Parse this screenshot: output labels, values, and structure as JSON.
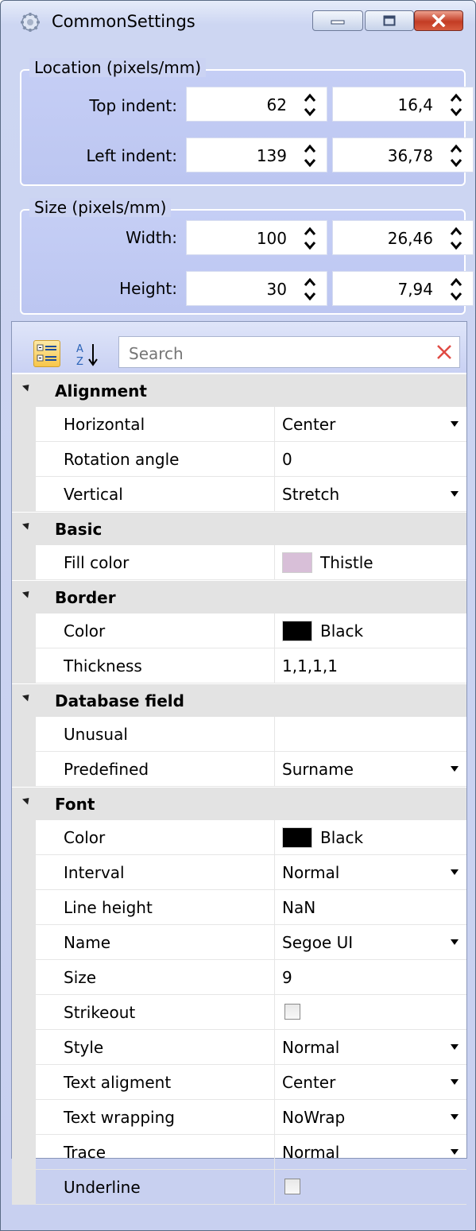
{
  "window": {
    "title": "CommonSettings",
    "icon": "gear-icon",
    "buttons": {
      "minimize": "minimize-icon",
      "maximize": "maximize-icon",
      "close": "close-icon"
    }
  },
  "location": {
    "title": "Location (pixels/mm)",
    "rows": [
      {
        "label": "Top indent:",
        "pixels": "62",
        "mm": "16,4"
      },
      {
        "label": "Left indent:",
        "pixels": "139",
        "mm": "36,78"
      }
    ]
  },
  "size": {
    "title": "Size (pixels/mm)",
    "rows": [
      {
        "label": "Width:",
        "pixels": "100",
        "mm": "26,46"
      },
      {
        "label": "Height:",
        "pixels": "30",
        "mm": "7,94"
      }
    ]
  },
  "toolbar": {
    "categorized_icon": "categorized-icon",
    "sort_icon": "sort-az-icon",
    "search_placeholder": "Search",
    "clear_icon": "clear-search-icon"
  },
  "categories": [
    {
      "name": "Alignment",
      "props": [
        {
          "name": "Horizontal",
          "value": "Center",
          "dropdown": true
        },
        {
          "name": "Rotation angle",
          "value": "0"
        },
        {
          "name": "Vertical",
          "value": "Stretch",
          "dropdown": true
        }
      ]
    },
    {
      "name": "Basic",
      "props": [
        {
          "name": "Fill color",
          "value": "Thistle",
          "swatch": "#d8bfd8"
        }
      ]
    },
    {
      "name": "Border",
      "props": [
        {
          "name": "Color",
          "value": "Black",
          "swatch": "#000000"
        },
        {
          "name": "Thickness",
          "value": "1,1,1,1"
        }
      ]
    },
    {
      "name": "Database field",
      "props": [
        {
          "name": "Unusual",
          "value": ""
        },
        {
          "name": "Predefined",
          "value": "Surname",
          "dropdown": true
        }
      ]
    },
    {
      "name": "Font",
      "props": [
        {
          "name": "Color",
          "value": "Black",
          "swatch": "#000000"
        },
        {
          "name": "Interval",
          "value": "Normal",
          "dropdown": true
        },
        {
          "name": "Line height",
          "value": "NaN"
        },
        {
          "name": "Name",
          "value": "Segoe UI",
          "dropdown": true
        },
        {
          "name": "Size",
          "value": "9"
        },
        {
          "name": "Strikeout",
          "checkbox": true,
          "checked": false
        },
        {
          "name": "Style",
          "value": "Normal",
          "dropdown": true
        },
        {
          "name": "Text aligment",
          "value": "Center",
          "dropdown": true
        },
        {
          "name": "Text wrapping",
          "value": "NoWrap",
          "dropdown": true
        },
        {
          "name": "Trace",
          "value": "Normal",
          "dropdown": true
        },
        {
          "name": "Underline",
          "checkbox": true,
          "checked": false
        }
      ]
    }
  ]
}
